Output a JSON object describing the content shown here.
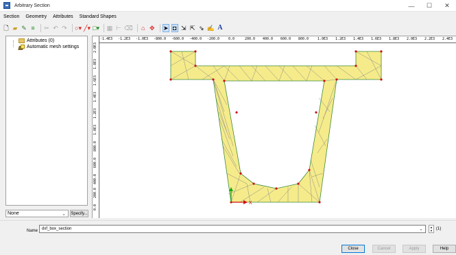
{
  "window": {
    "title": "Arbitrary Section",
    "minimize": "—",
    "maximize": "☐",
    "close": "✕"
  },
  "menu": [
    "Section",
    "Geometry",
    "Attributes",
    "Standard Shapes"
  ],
  "tree": {
    "items": [
      {
        "label": "Attributes (0)",
        "icon": "folder-icon"
      },
      {
        "label": "Automatic mesh settings",
        "icon": "mesh-settings-icon"
      }
    ]
  },
  "filter": {
    "selected": "None",
    "specify_label": "Specify..."
  },
  "rulers": {
    "top": [
      "-1.4E3",
      "-1.2E3",
      "-1.0E3",
      "-800.0",
      "-600.0",
      "-400.0",
      "-200.0",
      "0.0",
      "200.0",
      "400.0",
      "600.0",
      "800.0",
      "1.0E3",
      "1.2E3",
      "1.4E3",
      "1.6E3",
      "1.8E3",
      "2.0E3",
      "2.2E3",
      "2.4E3"
    ],
    "left": [
      "2.0E3",
      "1.8E3",
      "1.6E3",
      "1.4E3",
      "1.2E3",
      "1.0E3",
      "800.0",
      "600.0",
      "400.0",
      "200.0",
      "0.0"
    ]
  },
  "axes": {
    "x_label": "X"
  },
  "name_row": {
    "label": "Name",
    "value": "dxf_box_section",
    "count": "(1)"
  },
  "buttons": {
    "close": "Close",
    "cancel": "Cancel",
    "apply": "Apply",
    "help": "Help"
  },
  "colors": {
    "section_fill": "#f5eb8a",
    "mesh_line": "#8a8a8a",
    "outline": "#3a8a3a",
    "node": "#cc1111",
    "axis_y": "#11aa11",
    "axis_x": "#cc1111"
  }
}
